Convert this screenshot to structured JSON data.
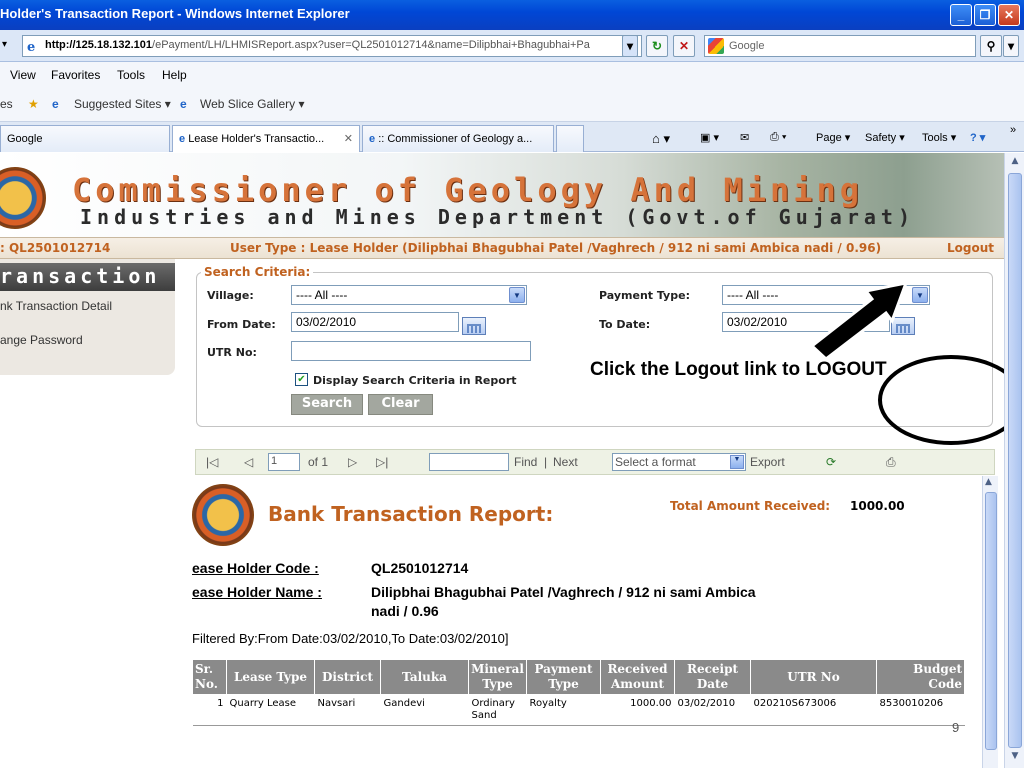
{
  "window": {
    "title": "Holder's Transaction Report - Windows Internet Explorer"
  },
  "address": {
    "url_host": "http://125.18.132.101",
    "url_rest": "/ePayment/LH/LHMISReport.aspx?user=QL2501012714&name=Dilipbhai+Bhagubhai+Pa",
    "search_placeholder": "Google"
  },
  "menu": [
    "View",
    "Favorites",
    "Tools",
    "Help"
  ],
  "favorites": {
    "suggested": "Suggested Sites ▾",
    "webslice": "Web Slice Gallery ▾"
  },
  "tabs": [
    {
      "label": "Google"
    },
    {
      "label": "Lease Holder's Transactio..."
    },
    {
      "label": ":: Commissioner of Geology a..."
    }
  ],
  "tab_tools": {
    "page": "Page ▾",
    "safety": "Safety ▾",
    "tools": "Tools ▾"
  },
  "banner": {
    "title": "Commissioner of Geology And Mining",
    "subtitle": "Industries and Mines Department (Govt.of Gujarat)"
  },
  "info": {
    "user_code": ": QL2501012714",
    "user_type": "User Type : Lease Holder (Dilipbhai Bhagubhai Patel /Vaghrech / 912 ni sami Ambica nadi / 0.96)",
    "logout": "Logout"
  },
  "sidebar": {
    "heading": "ransaction",
    "items": [
      {
        "label": "nk Transaction Detail"
      },
      {
        "label": "ange Password"
      }
    ]
  },
  "criteria": {
    "legend": "Search Criteria:",
    "village_label": "Village:",
    "village_value": "---- All ----",
    "payment_type_label": "Payment Type:",
    "payment_type_value": "---- All ----",
    "from_date_label": "From Date:",
    "from_date_value": "03/02/2010",
    "to_date_label": "To Date:",
    "to_date_value": "03/02/2010",
    "utr_label": "UTR No:",
    "utr_value": "",
    "display_checkbox_label": "Display Search Criteria in Report",
    "display_checked": true,
    "search_button": "Search",
    "clear_button": "Clear"
  },
  "annotation": "Click the Logout link to LOGOUT",
  "report_toolbar": {
    "page": "1",
    "of_pages": "of 1",
    "find": "Find",
    "separator": "|",
    "next": "Next",
    "format": "Select a format",
    "export": "Export"
  },
  "report": {
    "title": "Bank Transaction Report:",
    "total_label": "Total Amount Received:",
    "total_value": "1000.00",
    "holder_code_label": "ease Holder Code :",
    "holder_code_value": "QL2501012714",
    "holder_name_label": "ease Holder Name :",
    "holder_name_value_1": "Dilipbhai Bhagubhai Patel /Vaghrech / 912 ni sami Ambica",
    "holder_name_value_2": "nadi / 0.96",
    "filtered_by": "Filtered By:From Date:03/02/2010,To Date:03/02/2010]",
    "columns": [
      "Sr. No.",
      "Lease Type",
      "District",
      "Taluka",
      "Mineral Type",
      "Payment Type",
      "Received Amount",
      "Receipt Date",
      "UTR No",
      "Budget Code"
    ],
    "rows": [
      [
        "1",
        "Quarry Lease",
        "Navsari",
        "Gandevi",
        "Ordinary Sand",
        "Royalty",
        "1000.00",
        "03/02/2010",
        "020210S673006",
        "8530010206"
      ]
    ]
  },
  "slide_number": "9"
}
